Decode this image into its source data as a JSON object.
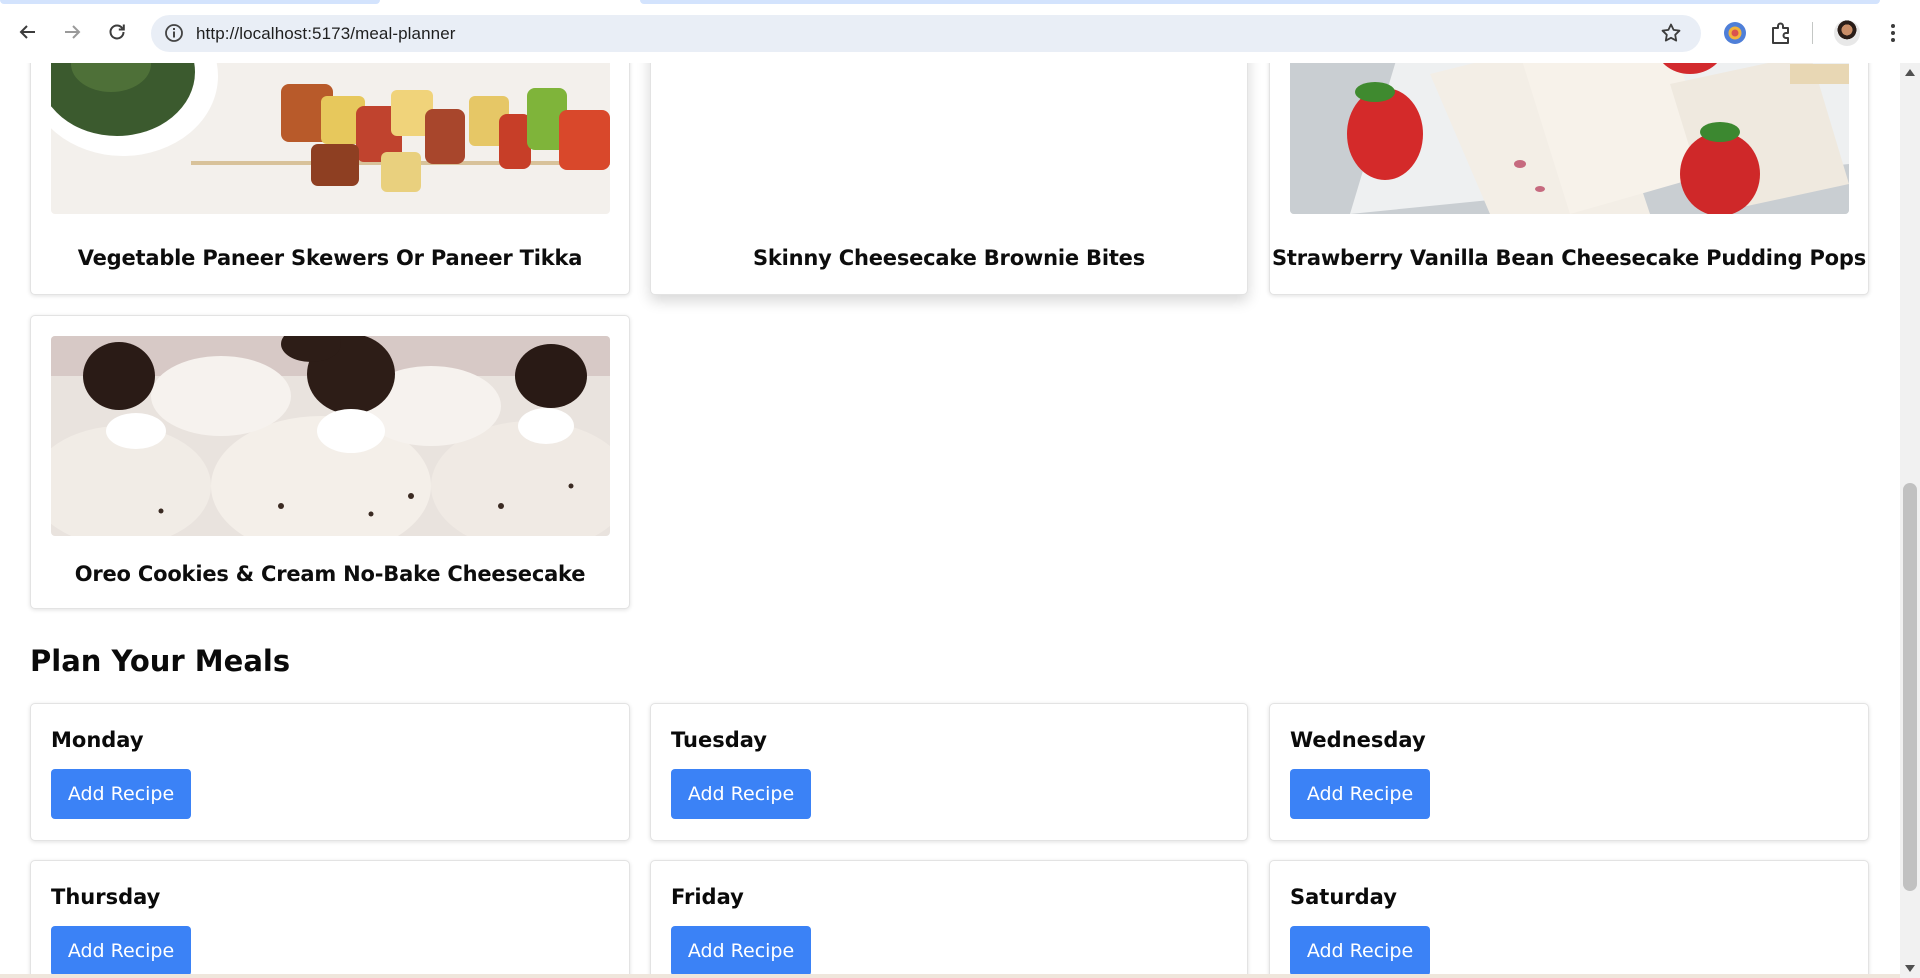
{
  "browser": {
    "url": "http://localhost:5173/meal-planner",
    "icons": [
      "back-arrow-icon",
      "forward-arrow-icon",
      "reload-icon",
      "site-info-icon",
      "bookmark-star-icon",
      "extension-icon",
      "puzzle-icon",
      "profile-avatar",
      "more-menu-icon"
    ]
  },
  "recipes": [
    {
      "title": "Vegetable Paneer Skewers Or Paneer Tikka"
    },
    {
      "title": "Skinny Cheesecake Brownie Bites"
    },
    {
      "title": "Strawberry Vanilla Bean Cheesecake Pudding Pops"
    },
    {
      "title": "Oreo Cookies & Cream No-Bake Cheesecake"
    }
  ],
  "planner": {
    "title": "Plan Your Meals",
    "days": [
      {
        "name": "Monday",
        "button": "Add Recipe"
      },
      {
        "name": "Tuesday",
        "button": "Add Recipe"
      },
      {
        "name": "Wednesday",
        "button": "Add Recipe"
      },
      {
        "name": "Thursday",
        "button": "Add Recipe"
      },
      {
        "name": "Friday",
        "button": "Add Recipe"
      },
      {
        "name": "Saturday",
        "button": "Add Recipe"
      }
    ]
  },
  "colors": {
    "accent": "#3b82f6",
    "omnibox": "#e9eef6"
  }
}
